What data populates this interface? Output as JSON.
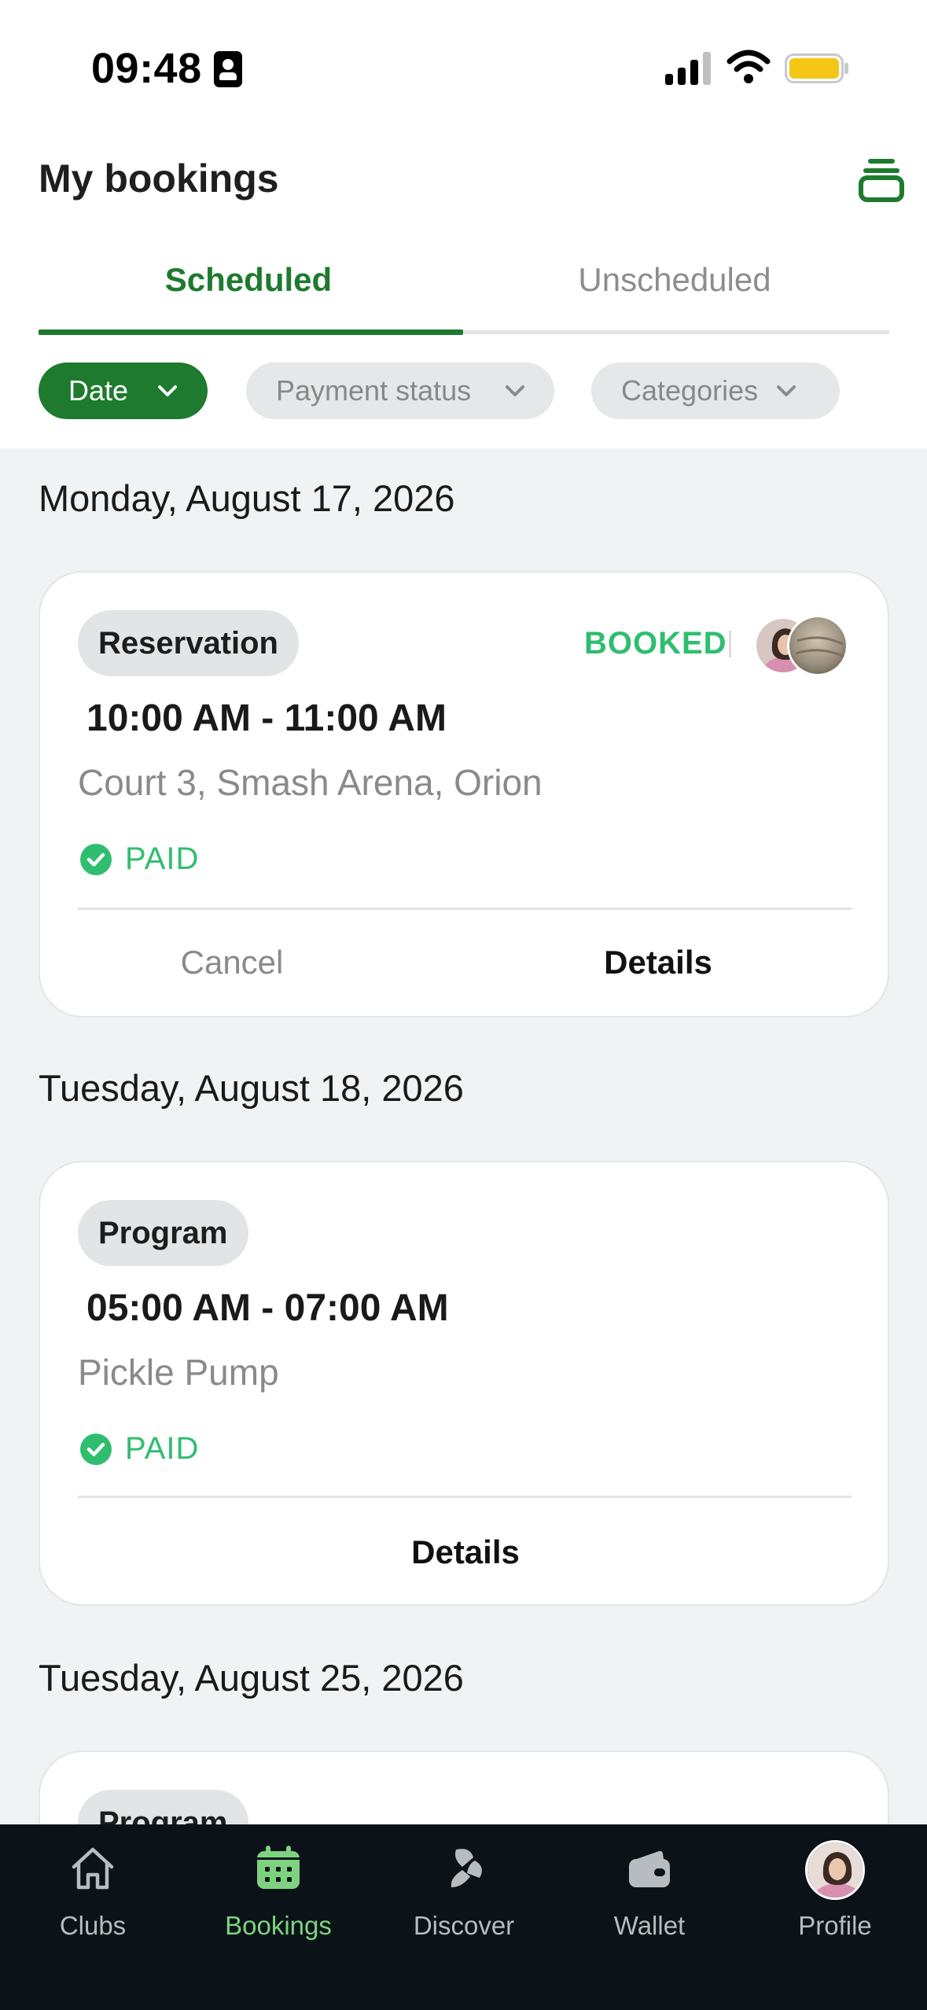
{
  "status_bar": {
    "time": "09:48"
  },
  "header": {
    "title": "My bookings",
    "tabs": [
      {
        "label": "Scheduled",
        "active": true
      },
      {
        "label": "Unscheduled",
        "active": false
      }
    ],
    "filters": [
      {
        "label": "Date",
        "active": true
      },
      {
        "label": "Payment status",
        "active": false
      },
      {
        "label": "Categories",
        "active": false
      }
    ]
  },
  "groups": [
    {
      "date": "Monday, August 17, 2026",
      "booking": {
        "type": "Reservation",
        "status": "BOOKED",
        "time": "10:00 AM - 11:00 AM",
        "location": "Court 3, Smash Arena, Orion",
        "payment": "PAID",
        "cancel_label": "Cancel",
        "details_label": "Details"
      }
    },
    {
      "date": "Tuesday, August 18, 2026",
      "booking": {
        "type": "Program",
        "time": "05:00 AM - 07:00 AM",
        "location": "Pickle Pump",
        "payment": "PAID",
        "details_label": "Details"
      }
    },
    {
      "date": "Tuesday, August 25, 2026",
      "booking": {
        "type": "Program"
      }
    }
  ],
  "nav": {
    "items": [
      {
        "label": "Clubs",
        "icon": "home-icon"
      },
      {
        "label": "Bookings",
        "icon": "calendar-icon",
        "active": true
      },
      {
        "label": "Discover",
        "icon": "discover-icon"
      },
      {
        "label": "Wallet",
        "icon": "wallet-icon"
      },
      {
        "label": "Profile",
        "icon": "avatar"
      }
    ]
  },
  "colors": {
    "brand_green": "#1e7a2e",
    "status_green": "#2fbe6f",
    "nav_active": "#7ed27f",
    "nav_bg": "#0b1318",
    "battery": "#f5c518"
  }
}
